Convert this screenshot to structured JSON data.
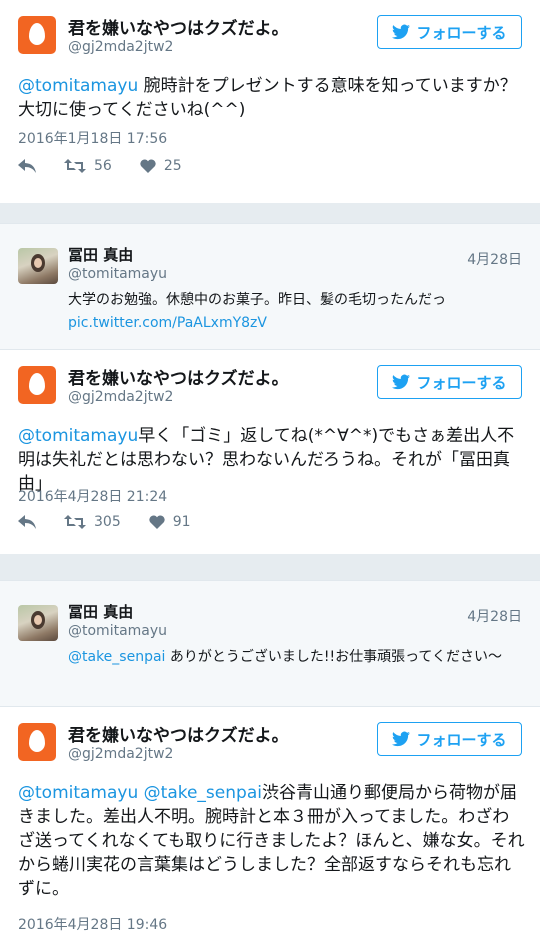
{
  "colors": {
    "accent": "#1da1f2",
    "egg_avatar": "#f26522",
    "muted": "#657786",
    "link": "#1b95e0"
  },
  "follow_label": "フォローする",
  "tweets": [
    {
      "author": {
        "name": "君を嫌いなやつはクズだよ。",
        "handle": "@gj2mda2jtw2"
      },
      "mention": "@tomitamayu",
      "text_1": " 腕時計をプレゼントする意味を知っていますか？大切に使ってくださいね(^^)",
      "timestamp": "2016年1月18日 17:56",
      "retweets": "56",
      "likes": "25"
    },
    {
      "author": {
        "name": "君を嫌いなやつはクズだよ。",
        "handle": "@gj2mda2jtw2"
      },
      "mention": "@tomitamayu",
      "text_1": "早く「ゴミ」返してね(*^∀^*)でもさぁ差出人不明は失礼だとは思わない？思わないんだろうね。それが「冨田真由」",
      "timestamp": "2016年4月28日 21:24",
      "retweets": "305",
      "likes": "91"
    },
    {
      "author": {
        "name": "君を嫌いなやつはクズだよ。",
        "handle": "@gj2mda2jtw2"
      },
      "mention": "@tomitamayu",
      "mention_2": "@take_senpai",
      "text_1": "渋谷青山通り郵便局から荷物が届きました。差出人不明。腕時計と本３冊が入ってました。わざわざ送ってくれなくても取りに行きましたよ？ほんと、嫌な女。それから蜷川実花の言葉集はどうしました？全部返すならそれも忘れずに。",
      "timestamp": "2016年4月28日 19:46"
    }
  ],
  "quotes": [
    {
      "name": "冨田 真由",
      "handle": "@tomitamayu",
      "date": "4月28日",
      "text": "大学のお勉強。休憩中のお菓子。昨日、髪の毛切ったんだっ",
      "link": "pic.twitter.com/PaALxmY8zV"
    },
    {
      "name": "冨田 真由",
      "handle": "@tomitamayu",
      "date": "4月28日",
      "mention": "@take_senpai",
      "text": " ありがとうございました!!お仕事頑張ってください～"
    }
  ]
}
